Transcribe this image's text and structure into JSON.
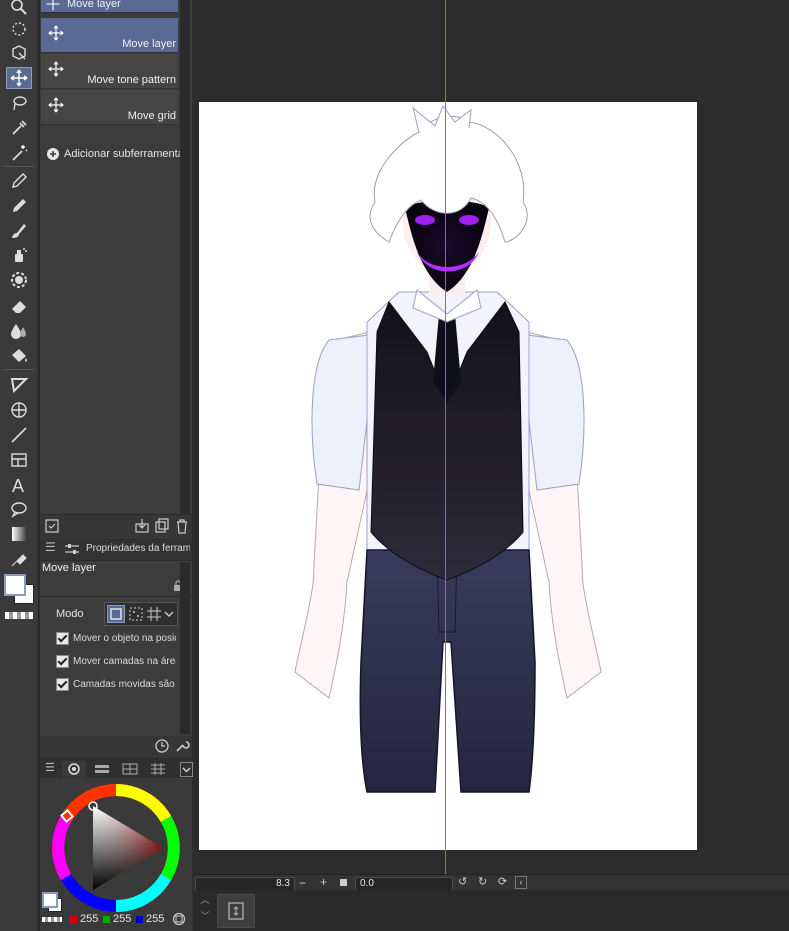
{
  "subtool_panel": {
    "header_label": "Move layer",
    "items": [
      {
        "label": "Move layer",
        "icon": "move-arrows-icon"
      },
      {
        "label": "Move tone pattern",
        "icon": "move-arrows-icon"
      },
      {
        "label": "Move grid",
        "icon": "move-arrows-icon"
      }
    ],
    "add_label": "Adicionar subferramenta"
  },
  "tool_property": {
    "tab_label": "Propriedades da ferramenta",
    "tool_name": "Move layer",
    "mode_label": "Modo",
    "checkboxes": [
      {
        "label": "Mover o objeto na posição o",
        "checked": true
      },
      {
        "label": "Mover camadas na área sele",
        "checked": true
      },
      {
        "label": "Camadas movidas são selec",
        "checked": true
      }
    ]
  },
  "color": {
    "r": "255",
    "g": "255",
    "b": "255",
    "main_color": "#ffffff",
    "sub_color": "#ffffff"
  },
  "navigator": {
    "zoom": "8.3",
    "rotation": "0.0"
  },
  "colors": {
    "accent": "#5a6a94",
    "guide": "#b04ad8",
    "panel": "#3c3c3c"
  }
}
